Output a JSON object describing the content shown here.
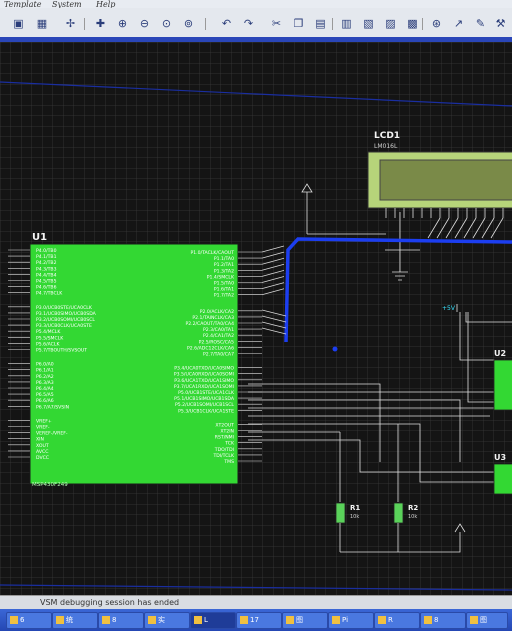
{
  "menu": {
    "items": [
      "Template",
      "System",
      "Help"
    ]
  },
  "toolbar": {
    "icons": [
      "save-icon",
      "grid-icon",
      "origin-icon",
      "pan-icon",
      "zoom-in-icon",
      "zoom-out-icon",
      "zoom-all-icon",
      "zoom-area-icon",
      "undo-icon",
      "redo-icon",
      "cut-icon",
      "copy-icon",
      "paste-icon",
      "block-copy-icon",
      "block-move-icon",
      "block-rotate-icon",
      "block-delete-icon",
      "pick-device-icon",
      "make-device-icon",
      "package-tool-icon",
      "decompose-icon"
    ]
  },
  "schematic": {
    "lcd": {
      "ref": "LCD1",
      "part": "LM016L"
    },
    "mcu": {
      "ref": "U1",
      "part": "MSP430F249",
      "left_pins": [
        "P4.0/TB0",
        "P4.1/TB1",
        "P4.2/TB2",
        "P4.3/TB3",
        "P4.4/TB4",
        "P4.5/TB5",
        "P4.6/TB6",
        "P4.7/TBCLK",
        "P3.0/UCB0STE/UCA0CLK",
        "P3.1/UCB0SIMO/UCB0SDA",
        "P3.2/UCB0SOMI/UCB0SCL",
        "P3.3/UCB0CLK/UCA0STE",
        "P5.4/MCLK",
        "P5.5/SMCLK",
        "P5.6/ACLK",
        "P5.7/TBOUTH/SVSOUT",
        "P6.0/A0",
        "P6.1/A1",
        "P6.2/A2",
        "P6.3/A3",
        "P6.4/A4",
        "P6.5/A5",
        "P6.6/A6",
        "P6.7/A7/SVSIN",
        "VREF+",
        "VREF-",
        "VEREF-/VREF-",
        "XIN",
        "XOUT",
        "AVCC",
        "DVCC"
      ],
      "right_pins": [
        "P1.0/TACLK/CAOUT",
        "P1.1/TA0",
        "P1.2/TA1",
        "P1.3/TA2",
        "P1.4/SMCLK",
        "P1.5/TA0",
        "P1.6/TA1",
        "P1.7/TA2",
        "P2.0/ACLK/CA2",
        "P2.1/TAINCLK/CA3",
        "P2.2/CAOUT/TA0/CA4",
        "P2.3/CA0/TA1",
        "P2.4/CA1/TA2",
        "P2.5/ROSC/CA5",
        "P2.6/ADC12CLK/CA6",
        "P2.7/TA0/CA7",
        "P3.4/UCA0TXD/UCA0SIMO",
        "P3.5/UCA0RXD/UCA0SOMI",
        "P3.6/UCA1TXD/UCA1SIMO",
        "P3.7/UCA1RXD/UCA1SOMI",
        "P5.0/UCB1STE/UCA1CLK",
        "P5.1/UCB1SIMO/UCB1SDA",
        "P5.2/UCB1SOMI/UCB1SCL",
        "P5.3/UCB1CLK/UCA1STE",
        "XT2OUT",
        "XT2IN",
        "RST/NMI",
        "TCK",
        "TDO/TDI",
        "TDI/TCLK",
        "TMS"
      ]
    },
    "resistors": [
      {
        "ref": "R1",
        "value": "10k"
      },
      {
        "ref": "R2",
        "value": "10k"
      }
    ],
    "ics": [
      {
        "ref": "U2"
      },
      {
        "ref": "U3"
      }
    ],
    "power_label": "+5V"
  },
  "status": {
    "message": "VSM debugging session has ended"
  },
  "taskbar": {
    "items": [
      {
        "label": "6"
      },
      {
        "label": "统"
      },
      {
        "label": "8"
      },
      {
        "label": "实"
      },
      {
        "label": "L"
      },
      {
        "label": "17"
      },
      {
        "label": "图"
      },
      {
        "label": "Pi"
      },
      {
        "label": "R"
      },
      {
        "label": "8"
      },
      {
        "label": "图"
      }
    ]
  }
}
